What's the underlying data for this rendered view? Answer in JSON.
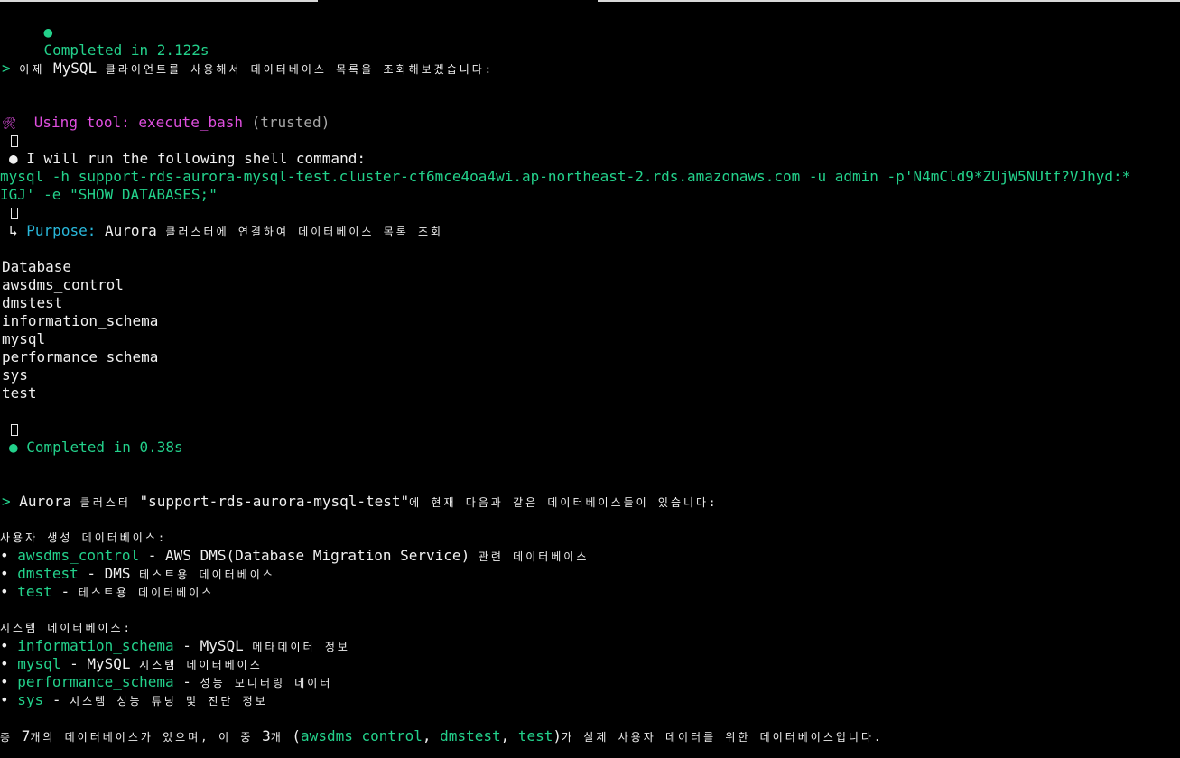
{
  "colors": {
    "background": "#000000",
    "green": "#23d18b",
    "magenta": "#e04fe0",
    "cyan": "#29b8db",
    "text": "#f0f0f0"
  },
  "run1": {
    "bullet": "●",
    "status": "Completed in 2.122s"
  },
  "msg1": {
    "prompt": ">",
    "pre": "이제",
    "tool": "MySQL",
    "post": "클라이언트를 사용해서 데이터베이스 목록을 조회해보겠습니다:"
  },
  "tool": {
    "icon": "🛠",
    "label": "Using tool:",
    "name": "execute_bash",
    "trust": "(trusted)"
  },
  "cmd": {
    "bullet": "●",
    "intro": "I will run the following shell command:",
    "line1": "mysql -h support-rds-aurora-mysql-test.cluster-cf6mce4oa4wi.ap-northeast-2.rds.amazonaws.com -u admin -p'N4mCld9*ZUjW5NUtf?VJhyd:*",
    "line2": "IGJ' -e \"SHOW DATABASES;\""
  },
  "purpose": {
    "arrow": "↳",
    "label": "Purpose:",
    "name": "Aurora",
    "text": "클러스터에 연결하여 데이터베이스 목록 조회"
  },
  "output": {
    "rows": [
      "Database",
      "awsdms_control",
      "dmstest",
      "information_schema",
      "mysql",
      "performance_schema",
      "sys",
      "test"
    ]
  },
  "run2": {
    "bullet": "●",
    "status": "Completed in 0.38s"
  },
  "summary": {
    "prompt": ">",
    "aurora": "Aurora",
    "cluster_word": "클러스터",
    "cluster_name": "\"support-rds-aurora-mysql-test\"",
    "tail": "에 현재 다음과 같은 데이터베이스들이 있습니다:"
  },
  "user_section": {
    "heading": "사용자 생성 데이터베이스:",
    "items": [
      {
        "bullet": "•",
        "name": "awsdms_control",
        "sep": " - ",
        "desc_en": "AWS DMS(Database Migration Service)",
        "desc_ko": "관련 데이터베이스"
      },
      {
        "bullet": "•",
        "name": "dmstest",
        "sep": " - ",
        "desc_en": "DMS",
        "desc_ko": "테스트용 데이터베이스"
      },
      {
        "bullet": "•",
        "name": "test",
        "sep": " - ",
        "desc_en": "",
        "desc_ko": "테스트용 데이터베이스"
      }
    ]
  },
  "system_section": {
    "heading": "시스템 데이터베이스:",
    "items": [
      {
        "bullet": "•",
        "name": "information_schema",
        "sep": " - ",
        "desc_en": "MySQL",
        "desc_ko": "메타데이터 정보"
      },
      {
        "bullet": "•",
        "name": "mysql",
        "sep": " - ",
        "desc_en": "MySQL",
        "desc_ko": "시스템 데이터베이스"
      },
      {
        "bullet": "•",
        "name": "performance_schema",
        "sep": " - ",
        "desc_en": "",
        "desc_ko": "성능 모니터링 데이터"
      },
      {
        "bullet": "•",
        "name": "sys",
        "sep": " - ",
        "desc_en": "",
        "desc_ko": "시스템 성능 튜닝 및 진단 정보"
      }
    ]
  },
  "footer": {
    "a": "총",
    "n7": "7",
    "b": "개의 데이터베이스가 있으며,",
    "c": "이 중",
    "n3": "3",
    "d": "개",
    "open": "(",
    "db1": "awsdms_control",
    "comma1": ", ",
    "db2": "dmstest",
    "comma2": ", ",
    "db3": "test",
    "close": ")",
    "e": "가 실제 사용자 데이터를 위한 데이터베이스입니다."
  }
}
